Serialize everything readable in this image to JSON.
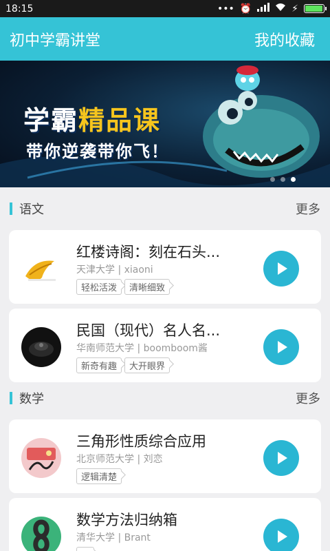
{
  "status_bar": {
    "time": "18:15",
    "icons": [
      "more-dots-icon",
      "alarm-icon",
      "signal-icon",
      "wifi-icon",
      "charging-icon",
      "battery-icon"
    ],
    "battery_fill": 0.95
  },
  "header": {
    "title": "初中学霸讲堂",
    "favorites_label": "我的收藏",
    "color": "#35c3d6"
  },
  "banner": {
    "title_part1": "学霸",
    "title_part2": "精品课",
    "subtitle": "带你逆袭带你飞！",
    "active_dot": 3,
    "dot_count": 3
  },
  "sections": [
    {
      "name": "语文",
      "more_label": "更多",
      "courses": [
        {
          "title": "红楼诗阁：刻在石头...",
          "meta": "天津大学 | xiaoni",
          "tags": [
            "轻松活泼",
            "清晰细致"
          ],
          "thumb": "banana-thumbnail"
        },
        {
          "title": "民国（现代）名人名...",
          "meta": "华南师范大学 | boomboom酱",
          "tags": [
            "新奇有趣",
            "大开眼界"
          ],
          "thumb": "dark-object-thumbnail"
        }
      ]
    },
    {
      "name": "数学",
      "more_label": "更多",
      "courses": [
        {
          "title": "三角形性质综合应用",
          "meta": "北京师范大学 | 刘恋",
          "tags": [
            "逻辑清楚"
          ],
          "thumb": "candy-thumbnail"
        },
        {
          "title": "数学方法归纳箱",
          "meta": "清华大学 | Brant",
          "tags": [
            "..."
          ],
          "thumb": "figure-eight-track-thumbnail"
        }
      ]
    }
  ]
}
